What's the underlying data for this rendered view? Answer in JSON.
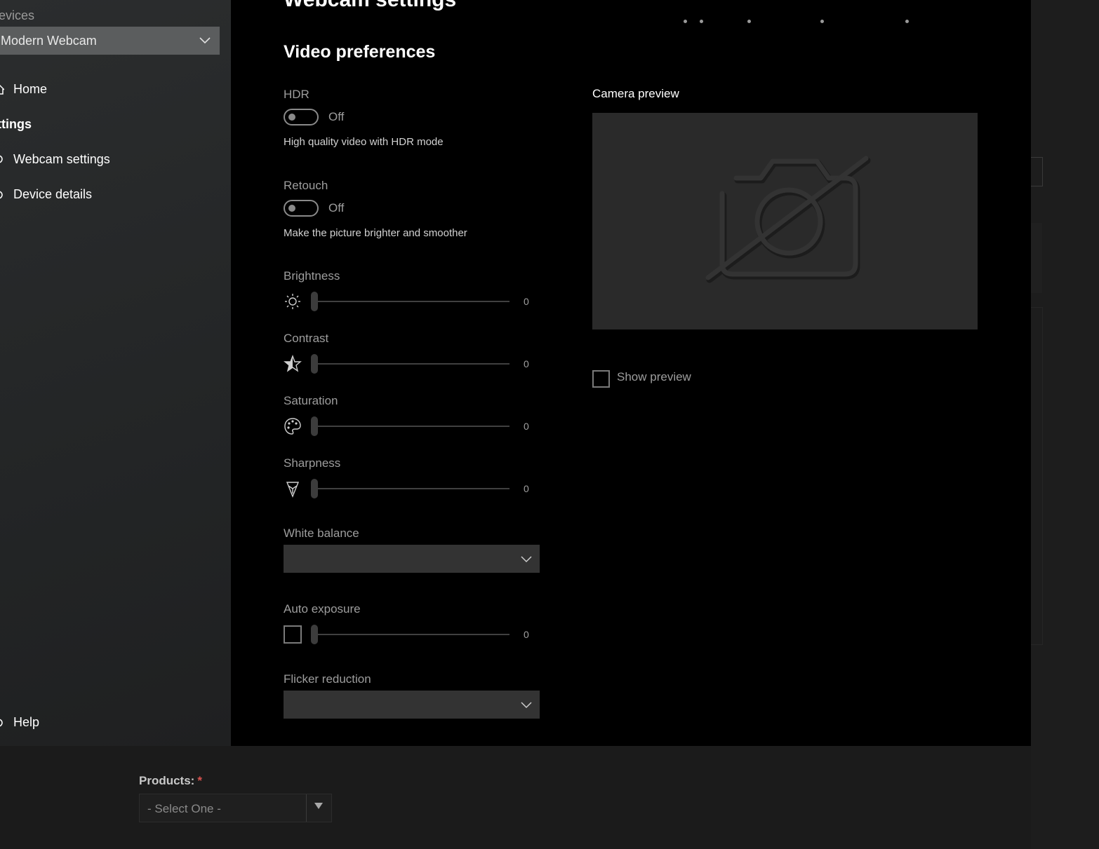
{
  "sidebar": {
    "devices_label": "evices",
    "device_selected": "Modern Webcam",
    "home": "Home",
    "settings_section": "ttings",
    "webcam_settings": "Webcam settings",
    "device_details": "Device details",
    "help": "Help"
  },
  "main": {
    "title": "Webcam settings",
    "heading": "Video preferences",
    "hdr": {
      "label": "HDR",
      "state": "Off",
      "description": "High quality video with HDR mode"
    },
    "retouch": {
      "label": "Retouch",
      "state": "Off",
      "description": "Make the picture brighter and smoother"
    },
    "sliders": [
      {
        "label": "Brightness",
        "icon": "sun-icon",
        "value": "0"
      },
      {
        "label": "Contrast",
        "icon": "star-icon",
        "value": "0"
      },
      {
        "label": "Saturation",
        "icon": "palette-icon",
        "value": "0"
      },
      {
        "label": "Sharpness",
        "icon": "sharpness-icon",
        "value": "0"
      }
    ],
    "white_balance": {
      "label": "White balance",
      "value": ""
    },
    "auto_exposure": {
      "label": "Auto exposure",
      "value": "0",
      "checked": false
    },
    "flicker_reduction": {
      "label": "Flicker reduction",
      "value": ""
    },
    "camera_preview": {
      "label": "Camera preview",
      "icon": "camera-off-icon"
    },
    "show_preview": {
      "label": "Show preview",
      "checked": false
    }
  },
  "background_page": {
    "products_label": "Products:",
    "required_marker": "*",
    "products_placeholder": "- Select One -"
  },
  "colors": {
    "main_bg": "#000000",
    "sidebar_bg": "#2b2d2e",
    "device_select_bg": "#5b5d5e",
    "dropdown_bg": "#333333",
    "preview_bg": "#2a2a2a",
    "required": "#d9534f"
  }
}
